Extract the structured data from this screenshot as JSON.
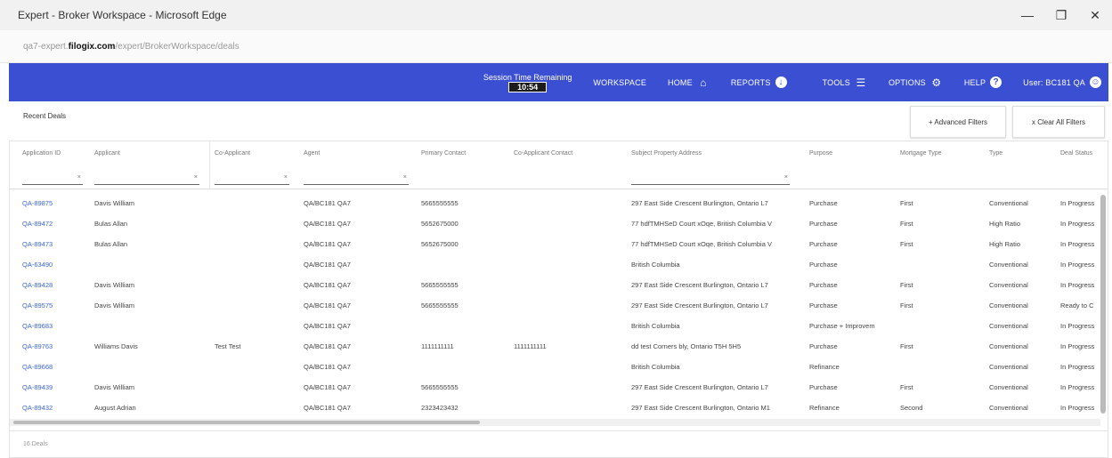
{
  "window": {
    "title": "Expert - Broker Workspace - Microsoft Edge",
    "minimize_icon": "minimize-icon",
    "restore_icon": "restore-icon",
    "close_icon": "close-icon"
  },
  "address": {
    "prefix": "qa7-expert.",
    "domain": "filogix.com",
    "path": "/expert/BrokerWorkspace/deals"
  },
  "nav": {
    "session_label": "Session Time Remaining",
    "session_time": "10:54",
    "workspace": "WORKSPACE",
    "home": "HOME",
    "reports": "REPORTS",
    "tools": "TOOLS",
    "options": "OPTIONS",
    "help": "HELP",
    "user": "User: BC181 QA",
    "color": "#3a4fd1"
  },
  "toolbar": {
    "recent_deals": "Recent Deals",
    "advanced_filters": "+ Advanced Filters",
    "clear_all_filters": "x Clear All Filters"
  },
  "grid": {
    "columns": [
      "Application ID",
      "Applicant",
      "Co-Applicant",
      "Agent",
      "Primary Contact",
      "Co-Applicant Contact",
      "Subject Property Address",
      "Purpose",
      "Mortgage Type",
      "Type",
      "Deal Status"
    ],
    "rows": [
      [
        "QA-89875",
        "Davis William",
        "",
        "QA/BC181 QA7",
        "5665555555",
        "",
        "297 East Side Crescent Burlington, Ontario L7",
        "Purchase",
        "First",
        "Conventional",
        "In Progress"
      ],
      [
        "QA-89472",
        "Bulas Allan",
        "",
        "QA/BC181 QA7",
        "5652675000",
        "",
        "77 hdfTMHSeD Court xOqe, British Columbia V",
        "Purchase",
        "First",
        "High Ratio",
        "In Progress"
      ],
      [
        "QA-89473",
        "Bulas Allan",
        "",
        "QA/BC181 QA7",
        "5652675000",
        "",
        "77 hdfTMHSeD Court xOqe, British Columbia V",
        "Purchase",
        "First",
        "High Ratio",
        "In Progress"
      ],
      [
        "QA-63490",
        "",
        "",
        "QA/BC181 QA7",
        "",
        "",
        "British Columbia",
        "Purchase",
        "",
        "Conventional",
        "In Progress"
      ],
      [
        "QA-89428",
        "Davis William",
        "",
        "QA/BC181 QA7",
        "5665555555",
        "",
        "297 East Side Crescent Burlington, Ontario L7",
        "Purchase",
        "First",
        "Conventional",
        "In Progress"
      ],
      [
        "QA-89575",
        "Davis William",
        "",
        "QA/BC181 QA7",
        "5665555555",
        "",
        "297 East Side Crescent Burlington, Ontario L7",
        "Purchase",
        "First",
        "Conventional",
        "Ready to C"
      ],
      [
        "QA-89683",
        "",
        "",
        "QA/BC181 QA7",
        "",
        "",
        "British Columbia",
        "Purchase + Improvem",
        "",
        "Conventional",
        "In Progress"
      ],
      [
        "QA-89763",
        "Williams Davis",
        "Test Test",
        "QA/BC181 QA7",
        "1111111111",
        "1111111111",
        "dd test Corners bly, Ontario T5H 5H5",
        "Purchase",
        "First",
        "Conventional",
        "In Progress"
      ],
      [
        "QA-89668",
        "",
        "",
        "QA/BC181 QA7",
        "",
        "",
        "British Columbia",
        "Refinance",
        "",
        "Conventional",
        "In Progress"
      ],
      [
        "QA-89439",
        "Davis William",
        "",
        "QA/BC181 QA7",
        "5665555555",
        "",
        "297 East Side Crescent Burlington, Ontario L7",
        "Purchase",
        "First",
        "Conventional",
        "In Progress"
      ],
      [
        "QA-89432",
        "August Adrian",
        "",
        "QA/BC181 QA7",
        "2323423432",
        "",
        "297 East Side Crescent Burlington, Ontario M1",
        "Refinance",
        "Second",
        "Conventional",
        "In Progress"
      ]
    ]
  },
  "footer": {
    "count": "16 Deals"
  }
}
